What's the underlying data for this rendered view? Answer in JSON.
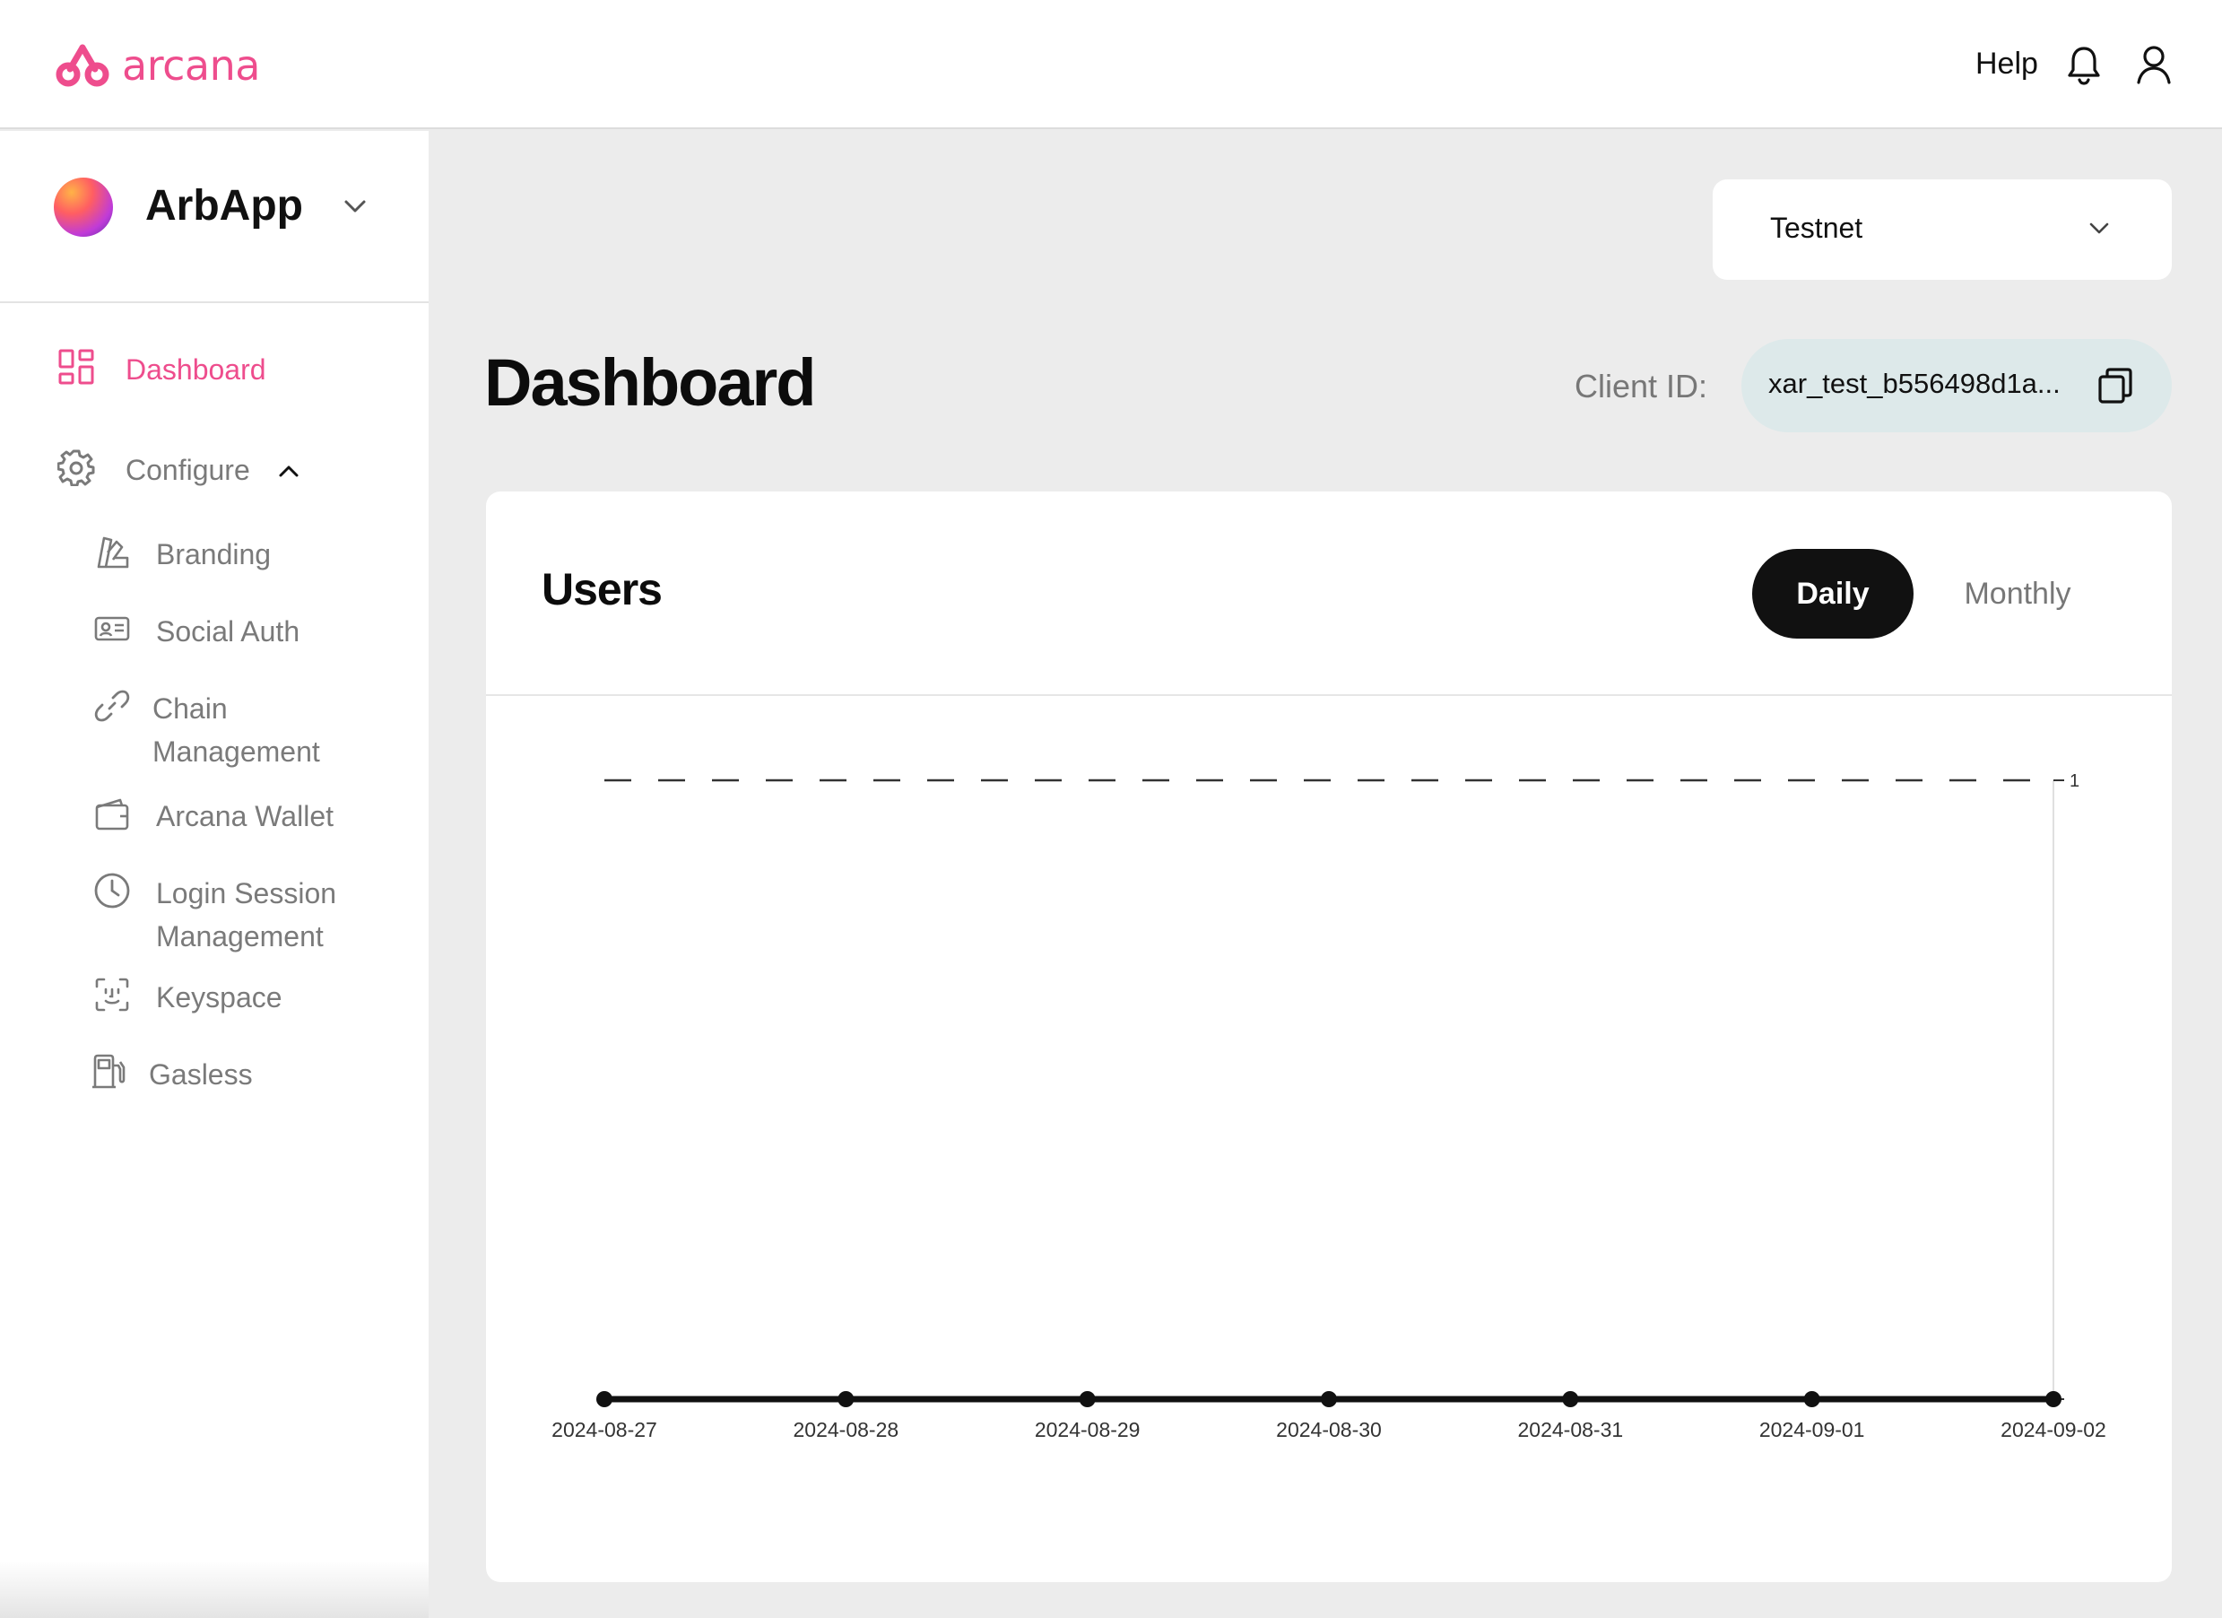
{
  "brand": {
    "name": "arcana",
    "color": "#ee4d8d",
    "icon": "arcana-logo-icon"
  },
  "header": {
    "help": "Help",
    "icons": [
      "bell-icon",
      "user-icon"
    ]
  },
  "sidebar": {
    "app": {
      "name": "ArbApp",
      "icon": "chevron-down-icon"
    },
    "dashboard": "Dashboard",
    "configure": "Configure",
    "items": [
      {
        "label": "Branding",
        "icon": "branding-icon"
      },
      {
        "label": "Social Auth",
        "icon": "id-card-icon"
      },
      {
        "label": "Chain",
        "label2": "Management",
        "icon": "link-icon"
      },
      {
        "label": "Arcana Wallet",
        "icon": "wallet-icon"
      },
      {
        "label": "Login Session",
        "label2": "Management",
        "icon": "clock-icon"
      },
      {
        "label": "Keyspace",
        "icon": "face-scan-icon"
      },
      {
        "label": "Gasless",
        "icon": "fuel-pump-icon"
      }
    ]
  },
  "main": {
    "network": "Testnet",
    "title": "Dashboard",
    "client_label": "Client ID:",
    "client_id": "xar_test_b556498d1a..."
  },
  "card": {
    "title": "Users",
    "toggle": {
      "daily": "Daily",
      "monthly": "Monthly",
      "selected": "Daily"
    }
  },
  "chart_data": {
    "type": "line",
    "title": "",
    "xlabel": "",
    "ylabel": "",
    "x": [
      "2024-08-27",
      "2024-08-28",
      "2024-08-29",
      "2024-08-30",
      "2024-08-31",
      "2024-09-01",
      "2024-09-02"
    ],
    "series": [
      {
        "values": [
          0,
          0,
          0,
          0,
          0,
          0,
          0
        ]
      }
    ],
    "ylim": [
      0,
      1
    ],
    "yticks": [
      "1"
    ],
    "grid": "dashed line at max",
    "y_axis_position": "right"
  }
}
